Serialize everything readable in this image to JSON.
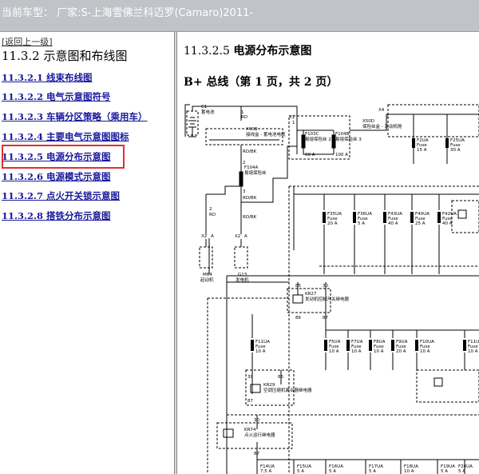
{
  "header": {
    "title": "当前车型：  厂家:S-上海雪佛兰科迈罗(Camaro)2011-"
  },
  "nav": {
    "back_label": "[返回上一级]",
    "section_title": "11.3.2 示意图和布线图",
    "items": [
      {
        "label": "11.3.2.1 线束布线图"
      },
      {
        "label": "11.3.2.2 电气示意图符号"
      },
      {
        "label": "11.3.2.3 车辆分区策略（乘用车）"
      },
      {
        "label": "11.3.2.4 主要电气示意图图标"
      },
      {
        "label": "11.3.2.5 电源分布示意图"
      },
      {
        "label": "11.3.2.6 电源模式示意图"
      },
      {
        "label": "11.3.2.7 点火开关锁示意图"
      },
      {
        "label": "11.3.2.8 搭铁分布示意图"
      }
    ]
  },
  "content": {
    "title_num": "11.3.2.5",
    "title_text": "电源分布示意图",
    "subtitle": "B+ 总线（第 1 页，共 2 页）"
  },
  "diagram": {
    "battery": {
      "id": "C1",
      "name": "蓄电池",
      "pin": "1",
      "wire": "RD"
    },
    "cable_block": {
      "id": "X60B",
      "name": "接线盒 - 蓄电池电缆"
    },
    "x1_conn": {
      "label": "X1",
      "pin": "1"
    },
    "mega_fuses": [
      {
        "id": "F103C",
        "desc": "易熔保险丝 2",
        "rating": "60 A"
      },
      {
        "id": "F104B",
        "desc": "易熔保险丝 3",
        "rating": "100 A"
      }
    ],
    "x50d": {
      "id": "X50D",
      "name": "保险丝盒 - 发动机舱"
    },
    "x4_conn": {
      "label": "X4",
      "pin": "1"
    },
    "fusible_link": {
      "id": "F104A",
      "name": "易熔保险丝",
      "pins": [
        "2",
        "3"
      ],
      "wires": [
        "RD/BK",
        "RD/BK",
        "RD/BK"
      ]
    },
    "starter": {
      "conn": "X2",
      "pin": "A",
      "wire_pin": "2",
      "wire": "RD",
      "id": "M64",
      "name": "起动机"
    },
    "generator": {
      "conn": "X2",
      "pin": "A",
      "wire_pin": "2",
      "wire": "RD",
      "id": "G13",
      "name": "发电机"
    },
    "top_fuses": [
      {
        "id": "F2UA",
        "word": "Fuse",
        "rating": "15 A"
      },
      {
        "id": "F25UA",
        "word": "Fuse",
        "rating": "30 A"
      }
    ],
    "row1_fuses": [
      {
        "id": "F35UA",
        "word": "Fuse",
        "rating": "20 A"
      },
      {
        "id": "F36UA",
        "word": "Fuse",
        "rating": "5 A"
      },
      {
        "id": "F43UA",
        "word": "Fuse",
        "rating": "40 A"
      },
      {
        "id": "F40UA",
        "word": "Fuse",
        "rating": "25 A"
      },
      {
        "id": "F42UA",
        "word": "Fuse",
        "rating": "40 A"
      }
    ],
    "starter_relay": {
      "id": "KR27",
      "name": "发动机控制开关继电器",
      "pins": [
        "85",
        "30",
        "86",
        "87"
      ]
    },
    "row2_left_fuse": {
      "id": "F11UA",
      "word": "Fuse",
      "rating": "10 A"
    },
    "row2_fuses": [
      {
        "id": "F5UA",
        "word": "Fuse",
        "rating": "10 A"
      },
      {
        "id": "F7UA",
        "word": "Fuse",
        "rating": "10 A"
      },
      {
        "id": "F8UA",
        "word": "Fuse",
        "rating": "10 A"
      },
      {
        "id": "F9UA",
        "word": "Fuse",
        "rating": "20 A"
      },
      {
        "id": "F10UA",
        "word": "Fuse",
        "rating": "10 A"
      },
      {
        "id": "F11U",
        "word": "Fuse",
        "rating": "10 A"
      }
    ],
    "ac_relay": {
      "id": "KR29",
      "name": "空调压缩机离合器继电器",
      "pins": [
        "30",
        "86",
        "87"
      ]
    },
    "run_relay": {
      "id": "KR74",
      "name": "点火运行继电器",
      "pins": [
        "30",
        "87"
      ]
    },
    "row3_fuses": [
      {
        "id": "F14UA",
        "word": "Fuse",
        "rating": "7.5 A"
      },
      {
        "id": "F15UA",
        "word": "Fuse",
        "rating": "5 A"
      },
      {
        "id": "F16UA",
        "word": "Fuse",
        "rating": "5 A"
      },
      {
        "id": "F17UA",
        "word": "Fuse",
        "rating": "5 A"
      },
      {
        "id": "F18UA",
        "word": "Fuse",
        "rating": "10 A"
      },
      {
        "id": "F19UA",
        "word": "Fuse",
        "rating": "5 A"
      },
      {
        "id": "F20UA",
        "word": "Fuse",
        "rating": "5 A"
      }
    ]
  }
}
